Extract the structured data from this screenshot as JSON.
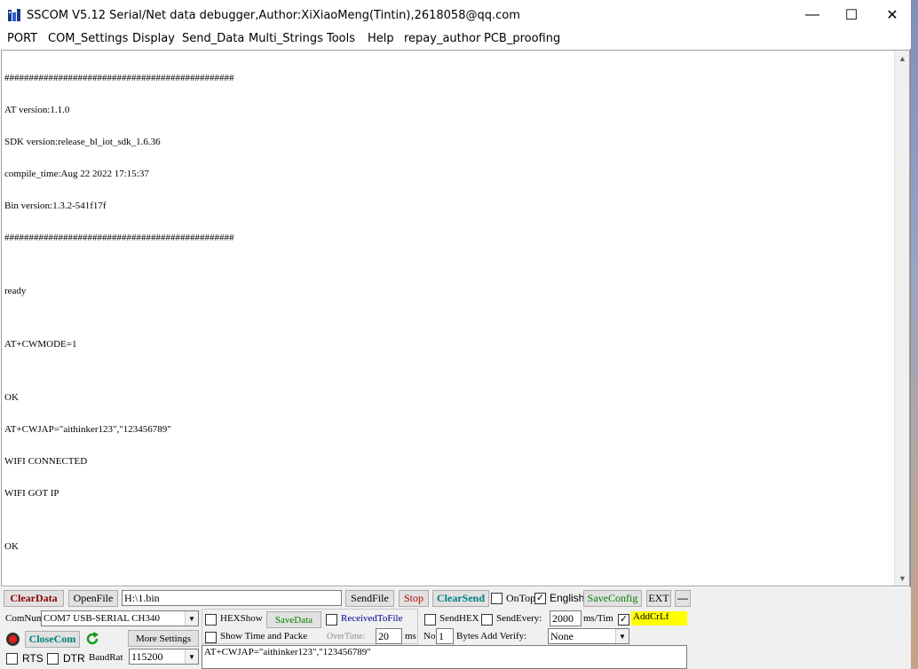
{
  "window": {
    "title": "SSCOM V5.12 Serial/Net data debugger,Author:XiXiaoMeng(Tintin),2618058@qq.com",
    "minimize_glyph": "—",
    "maximize_glyph": "☐",
    "close_glyph": "✕"
  },
  "menu": [
    "PORT",
    "COM_Settings",
    "Display",
    "Send_Data",
    "Multi_Strings",
    "Tools",
    "Help",
    "repay_author",
    "PCB_proofing"
  ],
  "receive": {
    "lines": [
      "###############################################",
      "AT version:1.1.0",
      "SDK version:release_bl_iot_sdk_1.6.36",
      "compile_time:Aug 22 2022 17:15:37",
      "Bin version:1.3.2-541f17f",
      "###############################################",
      "",
      "ready",
      "",
      "AT+CWMODE=1",
      "",
      "OK",
      "AT+CWJAP=\"aithinker123\",\"123456789\"",
      "WIFI CONNECTED",
      "WIFI GOT IP",
      "",
      "OK"
    ]
  },
  "row1": {
    "clear_data": "ClearData",
    "open_file": "OpenFile",
    "file_path": "H:\\1.bin",
    "send_file": "SendFile",
    "stop": "Stop",
    "clear_send": "ClearSend",
    "on_top": "OnTop",
    "english": "English",
    "save_config": "SaveConfig",
    "ext": "EXT",
    "collapse": "—"
  },
  "port": {
    "comnum_label": "ComNum",
    "comnum_value": "COM7 USB-SERIAL CH340",
    "close_com": "CloseCom",
    "more_settings": "More Settings",
    "rts": "RTS",
    "dtr": "DTR",
    "baud_label": "BaudRat",
    "baud_value": "115200"
  },
  "display": {
    "hex_show": "HEXShow",
    "save_data": "SaveData",
    "received_to_file": "ReceivedToFile",
    "show_time": "Show Time and Packe",
    "overtime_label": "OverTime:",
    "overtime_value": "20",
    "ms": "ms"
  },
  "send": {
    "send_hex": "SendHEX",
    "send_every": "SendEvery:",
    "interval": "2000",
    "ms_tim": "ms/Tim",
    "add_crlf": "AddCrLf",
    "no_label": "No",
    "no_value": "1",
    "bytes_add_verify": "Bytes Add Verify:",
    "verify_value": "None",
    "text": "AT+CWJAP=\"aithinker123\",\"123456789\""
  },
  "colors": {
    "clear_data": "#8b0000",
    "clear_send": "#008080",
    "save_config": "#008000",
    "save_data": "#008000",
    "received_to_file": "#00008b",
    "close_com": "#008080",
    "add_crlf_bg": "#ffff00"
  }
}
